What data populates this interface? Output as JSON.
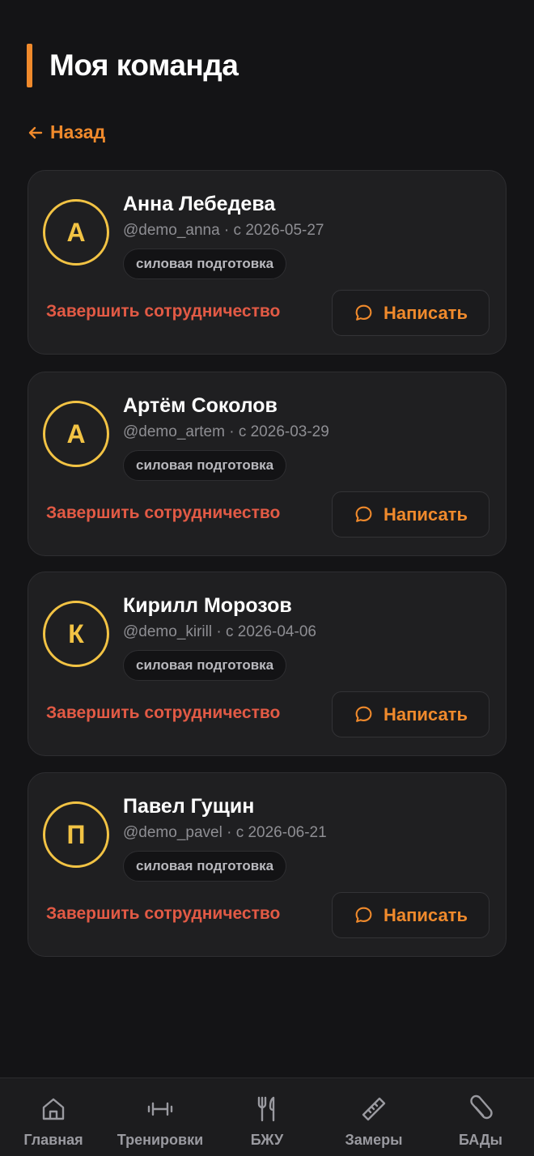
{
  "header": {
    "title": "Моя команда"
  },
  "back": {
    "label": "Назад"
  },
  "members": [
    {
      "initial": "А",
      "name": "Анна Лебедева",
      "meta": "@demo_anna · с 2026-05-27",
      "tag": "силовая подготовка",
      "end_label": "Завершить сотрудничество",
      "message_label": "Написать"
    },
    {
      "initial": "А",
      "name": "Артём Соколов",
      "meta": "@demo_artem · с 2026-03-29",
      "tag": "силовая подготовка",
      "end_label": "Завершить сотрудничество",
      "message_label": "Написать"
    },
    {
      "initial": "К",
      "name": "Кирилл Морозов",
      "meta": "@demo_kirill · с 2026-04-06",
      "tag": "силовая подготовка",
      "end_label": "Завершить сотрудничество",
      "message_label": "Написать"
    },
    {
      "initial": "П",
      "name": "Павел Гущин",
      "meta": "@demo_pavel · с 2026-06-21",
      "tag": "силовая подготовка",
      "end_label": "Завершить сотрудничество",
      "message_label": "Написать"
    }
  ],
  "tabbar": {
    "items": [
      {
        "label": "Главная",
        "icon": "home-icon"
      },
      {
        "label": "Тренировки",
        "icon": "dumbbell-icon"
      },
      {
        "label": "БЖУ",
        "icon": "fork-knife-icon"
      },
      {
        "label": "Замеры",
        "icon": "ruler-icon"
      },
      {
        "label": "БАДы",
        "icon": "pill-icon"
      }
    ]
  },
  "colors": {
    "accent": "#f08a2c",
    "avatar": "#f2c344",
    "danger": "#e25a45",
    "background": "#141416",
    "card": "#1f1f21"
  }
}
